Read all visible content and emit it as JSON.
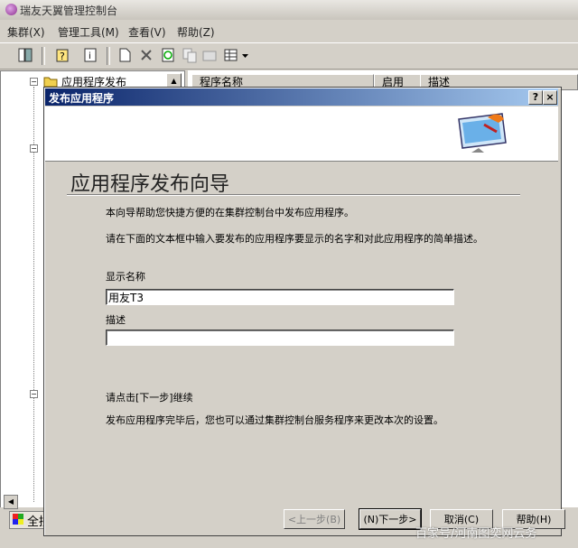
{
  "app": {
    "title": "瑞友天翼管理控制台"
  },
  "menu": {
    "items": [
      {
        "label": "集群(X)"
      },
      {
        "label": "管理工具(M)"
      },
      {
        "label": "查看(V)"
      },
      {
        "label": "帮助(Z)"
      }
    ]
  },
  "tree": {
    "root_label": "应用程序发布"
  },
  "list": {
    "columns": [
      {
        "label": "程序名称"
      },
      {
        "label": "启用"
      },
      {
        "label": "描述"
      }
    ]
  },
  "taskbar": {
    "ime_label": "全拼"
  },
  "dialog": {
    "title": "发布应用程序",
    "wizard_title": "应用程序发布向导",
    "intro": "本向导帮助您快捷方便的在集群控制台中发布应用程序。",
    "instruction": "请在下面的文本框中输入要发布的应用程序要显示的名字和对此应用程序的简单描述。",
    "display_name_label": "显示名称",
    "display_name_value": "用友T3",
    "description_label": "描述",
    "description_value": "",
    "continue_hint": "请点击[下一步]继续",
    "finish_hint": "发布应用程序完毕后，您也可以通过集群控制台服务程序来更改本次的设置。",
    "buttons": {
      "back": "<上一步(B)",
      "next": "(N)下一步>",
      "cancel": "取消(C)",
      "help": "帮助(H)"
    }
  },
  "watermark": "百家号/河南图奕网云务",
  "colors": {
    "dialog_title_start": "#0a246a",
    "dialog_title_end": "#a6caf0",
    "face": "#d4d0c8"
  }
}
